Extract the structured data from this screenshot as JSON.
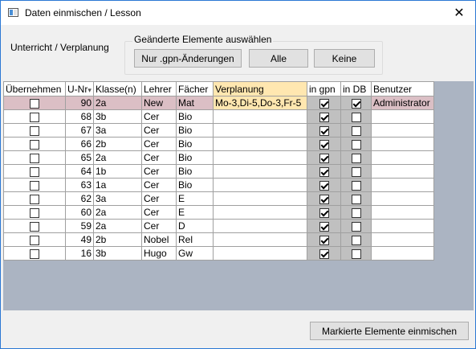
{
  "window": {
    "title": "Daten einmischen / Lesson",
    "close_glyph": "✕"
  },
  "left_label": "Unterricht / Verplanung",
  "group": {
    "title": "Geänderte Elemente auswählen",
    "buttons": [
      "Nur .gpn-Änderungen",
      "Alle",
      "Keine"
    ]
  },
  "grid": {
    "columns": [
      "Übernehmen",
      "U-Nr",
      "Klasse(n)",
      "Lehrer",
      "Fächer",
      "Verplanung",
      "in gpn",
      "in DB",
      "Benutzer"
    ],
    "sort_glyph": "▾",
    "rows": [
      {
        "take": false,
        "unr": "90",
        "klasse": "2a",
        "lehrer": "New",
        "fach": "Mat",
        "verplanung": "Mo-3,Di-5,Do-3,Fr-5",
        "gpn": true,
        "db": true,
        "benutzer": "Administrator",
        "selected": true
      },
      {
        "take": false,
        "unr": "68",
        "klasse": "3b",
        "lehrer": "Cer",
        "fach": "Bio",
        "verplanung": "",
        "gpn": true,
        "db": false,
        "benutzer": ""
      },
      {
        "take": false,
        "unr": "67",
        "klasse": "3a",
        "lehrer": "Cer",
        "fach": "Bio",
        "verplanung": "",
        "gpn": true,
        "db": false,
        "benutzer": ""
      },
      {
        "take": false,
        "unr": "66",
        "klasse": "2b",
        "lehrer": "Cer",
        "fach": "Bio",
        "verplanung": "",
        "gpn": true,
        "db": false,
        "benutzer": ""
      },
      {
        "take": false,
        "unr": "65",
        "klasse": "2a",
        "lehrer": "Cer",
        "fach": "Bio",
        "verplanung": "",
        "gpn": true,
        "db": false,
        "benutzer": ""
      },
      {
        "take": false,
        "unr": "64",
        "klasse": "1b",
        "lehrer": "Cer",
        "fach": "Bio",
        "verplanung": "",
        "gpn": true,
        "db": false,
        "benutzer": ""
      },
      {
        "take": false,
        "unr": "63",
        "klasse": "1a",
        "lehrer": "Cer",
        "fach": "Bio",
        "verplanung": "",
        "gpn": true,
        "db": false,
        "benutzer": ""
      },
      {
        "take": false,
        "unr": "62",
        "klasse": "3a",
        "lehrer": "Cer",
        "fach": "E",
        "verplanung": "",
        "gpn": true,
        "db": false,
        "benutzer": ""
      },
      {
        "take": false,
        "unr": "60",
        "klasse": "2a",
        "lehrer": "Cer",
        "fach": "E",
        "verplanung": "",
        "gpn": true,
        "db": false,
        "benutzer": ""
      },
      {
        "take": false,
        "unr": "59",
        "klasse": "2a",
        "lehrer": "Cer",
        "fach": "D",
        "verplanung": "",
        "gpn": true,
        "db": false,
        "benutzer": ""
      },
      {
        "take": false,
        "unr": "49",
        "klasse": "2b",
        "lehrer": "Nobel",
        "fach": "Rel",
        "verplanung": "",
        "gpn": true,
        "db": false,
        "benutzer": ""
      },
      {
        "take": false,
        "unr": "16",
        "klasse": "3b",
        "lehrer": "Hugo",
        "fach": "Gw",
        "verplanung": "",
        "gpn": true,
        "db": false,
        "benutzer": ""
      }
    ]
  },
  "footer": {
    "apply_label": "Markierte Elemente einmischen"
  },
  "colors": {
    "selected_row": "#dbbfc5",
    "verplanung_header": "#ffe7b0",
    "gray_column": "#c0c0c0",
    "grid_background": "#abb4c2"
  }
}
